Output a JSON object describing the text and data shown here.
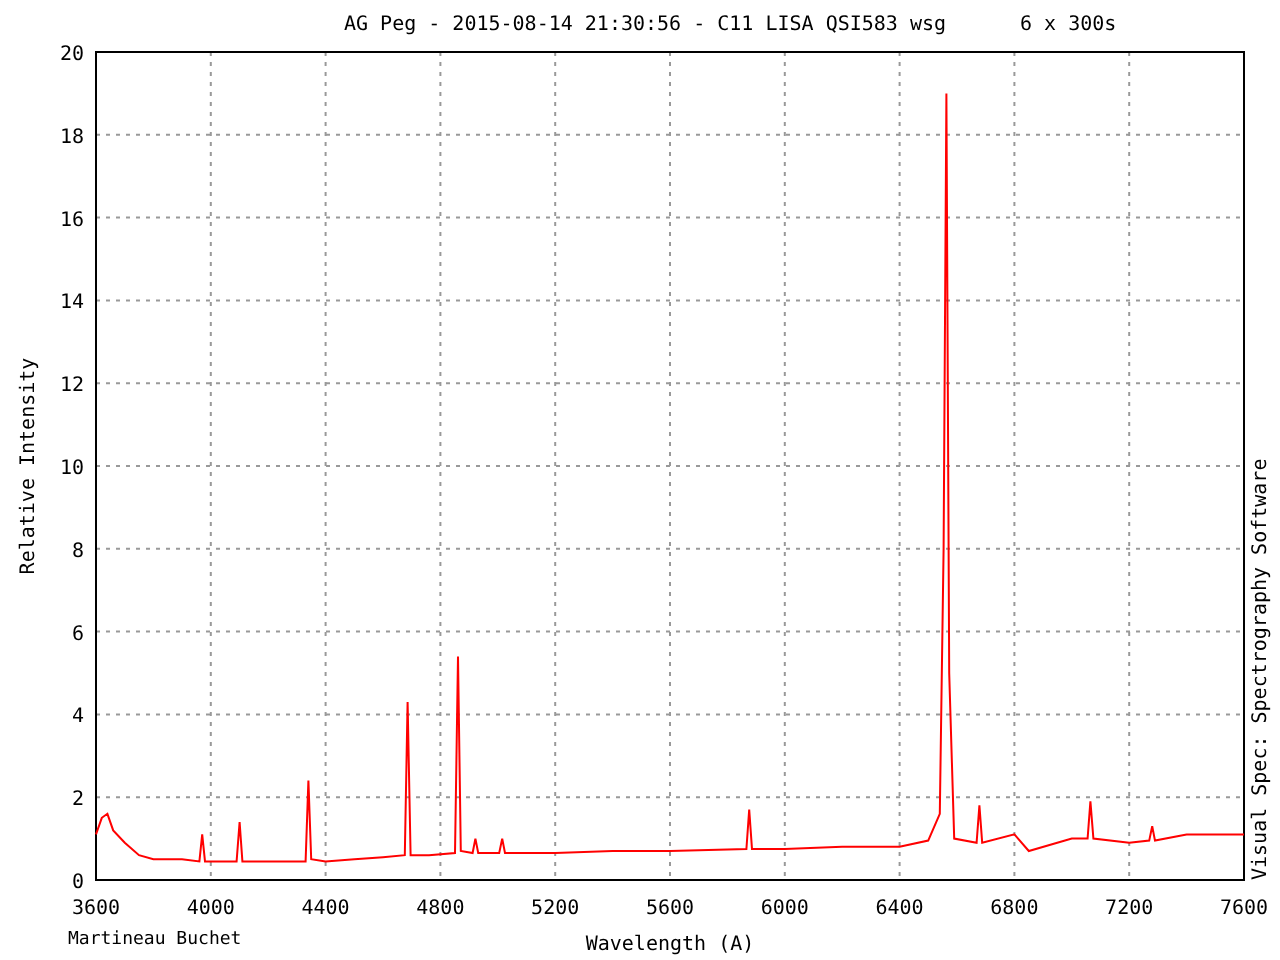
{
  "chart": {
    "title": "AG Peg - 2015-08-14 21:30:56 - C11 LISA  QSI583 wsg",
    "title_note": "6 x 300s",
    "author": "Martineau Buchet",
    "software": "Visual Spec: Spectrography Software",
    "chart_data": {
      "type": "line",
      "grid": true,
      "xlabel": "Wavelength (A)",
      "ylabel": "Relative Intensity",
      "xlim": [
        3600,
        7600
      ],
      "ylim": [
        0,
        20
      ],
      "xticks": [
        3600,
        4000,
        4400,
        4800,
        5200,
        5600,
        6000,
        6400,
        6800,
        7200,
        7600
      ],
      "yticks": [
        0,
        2,
        4,
        6,
        8,
        10,
        12,
        14,
        16,
        18,
        20
      ],
      "x": [
        3600,
        3620,
        3640,
        3660,
        3700,
        3750,
        3800,
        3850,
        3900,
        3960,
        3970,
        3980,
        4050,
        4090,
        4100,
        4110,
        4200,
        4330,
        4340,
        4350,
        4400,
        4500,
        4600,
        4676,
        4686,
        4696,
        4760,
        4851,
        4861,
        4871,
        4912,
        4922,
        4932,
        5005,
        5015,
        5025,
        5200,
        5400,
        5600,
        5866,
        5876,
        5886,
        6000,
        6200,
        6400,
        6500,
        6540,
        6553,
        6563,
        6573,
        6590,
        6668,
        6678,
        6688,
        6800,
        6850,
        7000,
        7055,
        7065,
        7075,
        7200,
        7270,
        7280,
        7290,
        7400,
        7600
      ],
      "series": [
        {
          "color": "#ff0000",
          "values": [
            1.1,
            1.5,
            1.6,
            1.2,
            0.9,
            0.6,
            0.5,
            0.5,
            0.5,
            0.45,
            1.1,
            0.45,
            0.45,
            0.45,
            1.4,
            0.45,
            0.45,
            0.45,
            2.4,
            0.5,
            0.45,
            0.5,
            0.55,
            0.6,
            4.3,
            0.6,
            0.6,
            0.65,
            5.4,
            0.7,
            0.65,
            1.0,
            0.65,
            0.65,
            1.0,
            0.65,
            0.65,
            0.7,
            0.7,
            0.75,
            1.7,
            0.75,
            0.75,
            0.8,
            0.8,
            0.95,
            1.6,
            8.0,
            19.0,
            5.0,
            1.0,
            0.9,
            1.8,
            0.9,
            1.1,
            0.7,
            1.0,
            1.0,
            1.9,
            1.0,
            0.9,
            0.95,
            1.3,
            0.95,
            1.1,
            1.1
          ]
        }
      ]
    }
  }
}
